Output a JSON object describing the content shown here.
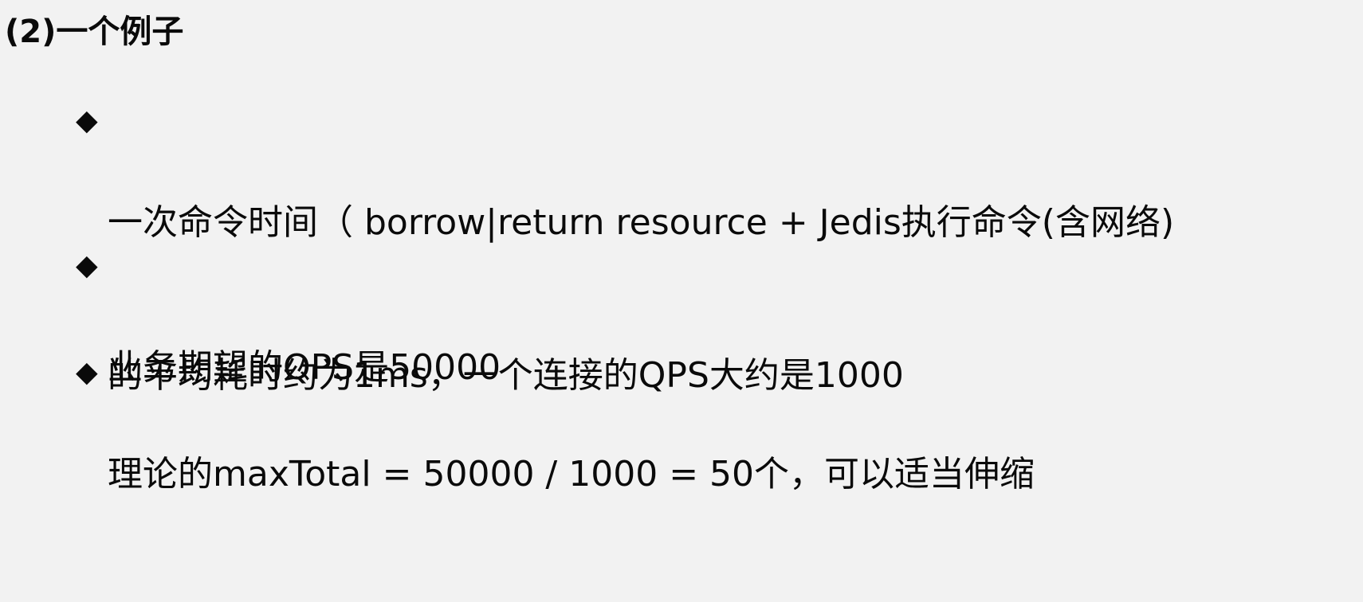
{
  "heading": "(2)一个例子",
  "bullet_symbol": "◆",
  "bullets": [
    {
      "line1": "一次命令时间（ borrow|return resource + Jedis执行命令(含网络)",
      "line2": "的平均耗时约为1ms，一个连接的QPS大约是1000"
    },
    {
      "line1": "业务期望的QPS是50000"
    },
    {
      "line1": "理论的maxTotal = 50000 / 1000 = 50个，可以适当伸缩"
    }
  ]
}
